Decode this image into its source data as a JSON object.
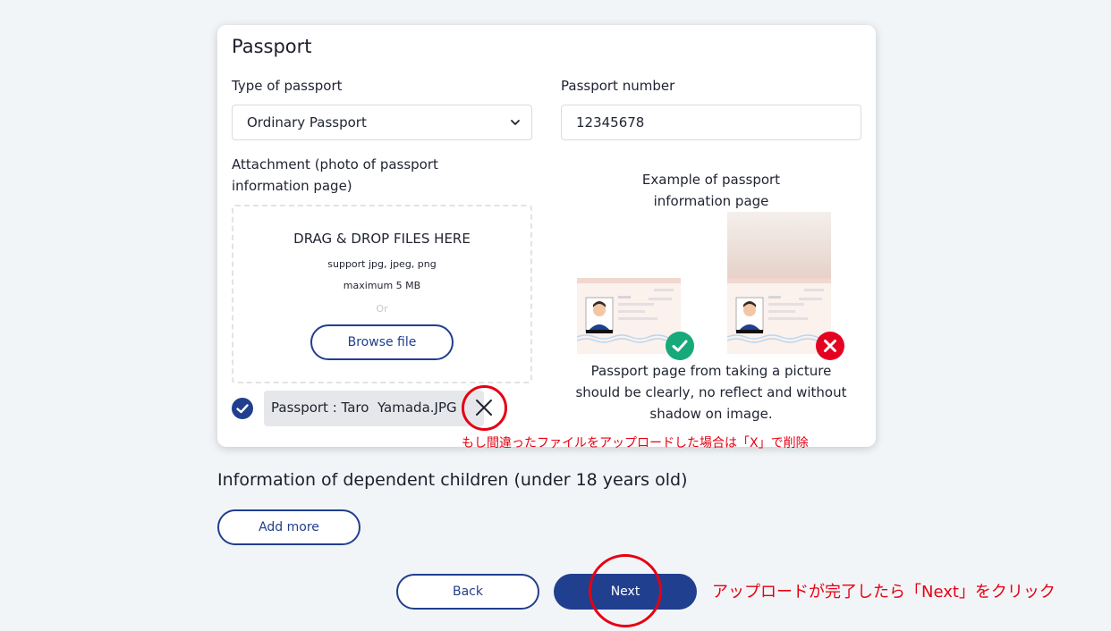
{
  "passport_card": {
    "title": "Passport",
    "type_label": "Type of passport",
    "type_value": "Ordinary Passport",
    "number_label": "Passport number",
    "number_value": "12345678",
    "attachment_label_line1": "Attachment (photo of passport",
    "attachment_label_line2": "information page)",
    "dropzone": {
      "title": "DRAG & DROP FILES HERE",
      "support": "support jpg, jpeg, png",
      "max_size": "maximum 5 MB",
      "or": "Or",
      "browse_label": "Browse file"
    },
    "uploaded_file": "Passport : Taro  Yamada.JPG",
    "example_title_line1": "Example of passport",
    "example_title_line2": "information page",
    "example_note_line1": "Passport page from taking a picture",
    "example_note_line2": "should be clearly, no reflect and without",
    "example_note_line3": "shadow on image."
  },
  "dependents": {
    "title": "Information of dependent children (under 18 years old)",
    "add_more_label": "Add more"
  },
  "footer": {
    "back_label": "Back",
    "next_label": "Next"
  },
  "annotations": {
    "remove_hint": "もし間違ったファイルをアップロードした場合は「X」で削除",
    "next_hint": "アップロードが完了したら「Next」をクリック"
  },
  "colors": {
    "primary": "#213f8f",
    "annotation": "#e60012",
    "success": "#17a97a",
    "error": "#e50021"
  },
  "icons": [
    "chevron-down-icon",
    "check-icon",
    "close-icon",
    "ok-badge-icon",
    "ng-badge-icon"
  ]
}
